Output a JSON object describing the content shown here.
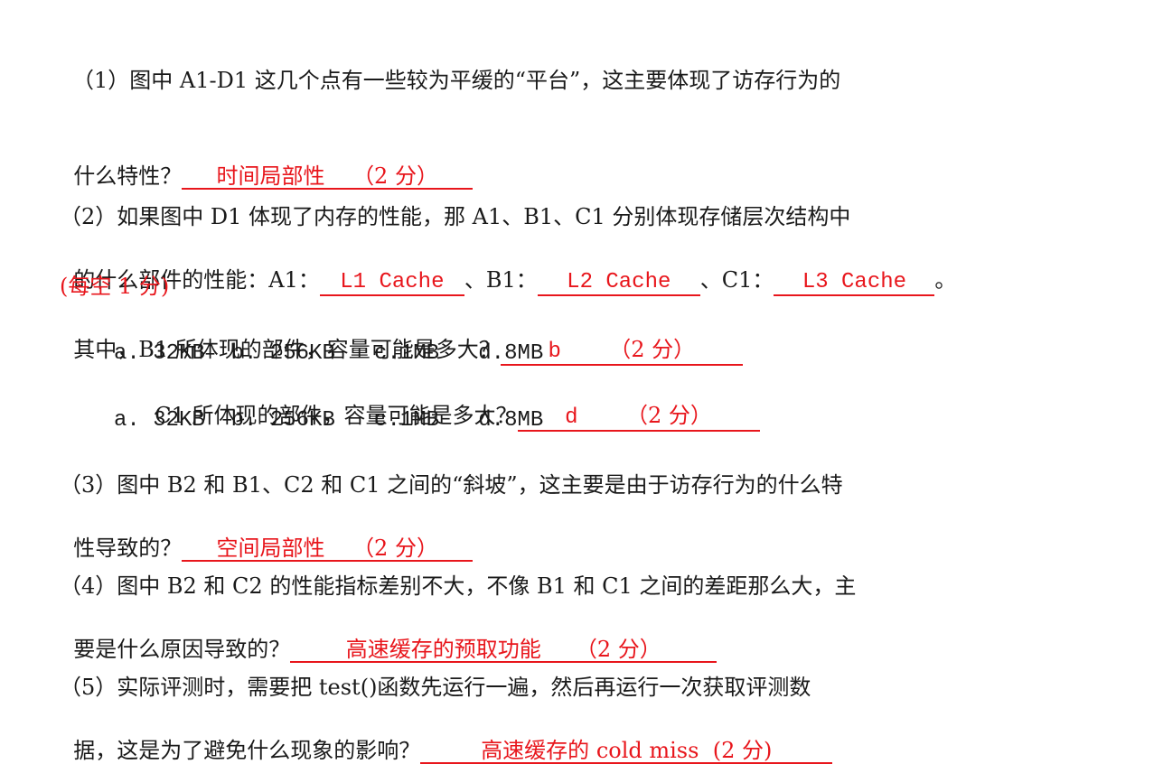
{
  "q1": {
    "line1": "（1）图中 A1-D1 这几个点有一些较为平缓的“平台”，这主要体现了访存行为的",
    "prefix": "什么特性？",
    "answer": "时间局部性",
    "score": "（2 分）"
  },
  "q2": {
    "line1": "（2）如果图中 D1 体现了内存的性能，那 A1、B1、C1 分别体现存储层次结构中",
    "line2_prefix": "的什么部件的性能：A1：",
    "ans_a1": "L1 Cache",
    "sep_b1": "、B1：",
    "ans_b1": "L2 Cache",
    "sep_c1": "、C1：",
    "ans_c1": "L3 Cache",
    "end": "。",
    "per_blank": "(每空 1 分)",
    "sub_b1_question": "其中，B1 所体现的部件，容量可能是多大？",
    "sub_b1_answer": "b",
    "sub_b1_score": "（2 分）",
    "options_1": "a. 32KB  b. 256KB   c.1MB   d.8MB",
    "sub_c1_question": "C1 所体现的部件，容量可能是多大？",
    "sub_c1_answer": "d",
    "sub_c1_score": "（2 分）",
    "options_2": "a. 32KB  b. 256KB   c.1MB   d.8MB"
  },
  "q3": {
    "line1": "（3）图中 B2 和 B1、C2 和 C1 之间的“斜坡”，这主要是由于访存行为的什么特",
    "prefix": "性导致的？",
    "answer": "空间局部性",
    "score": "（2 分）"
  },
  "q4": {
    "line1": "（4）图中 B2 和 C2 的性能指标差别不大，不像 B1 和 C1 之间的差距那么大，主",
    "prefix": "要是什么原因导致的？",
    "answer": "高速缓存的预取功能",
    "score": "（2 分）"
  },
  "q5": {
    "line1": "（5）实际评测时，需要把 test()函数先运行一遍，然后再运行一次获取评测数",
    "prefix": "据，这是为了避免什么现象的影响？",
    "answer": "高速缓存的 cold miss",
    "score": "(2 分)"
  },
  "colors": {
    "answer": "#e8161c",
    "text": "#1a1a1a"
  }
}
